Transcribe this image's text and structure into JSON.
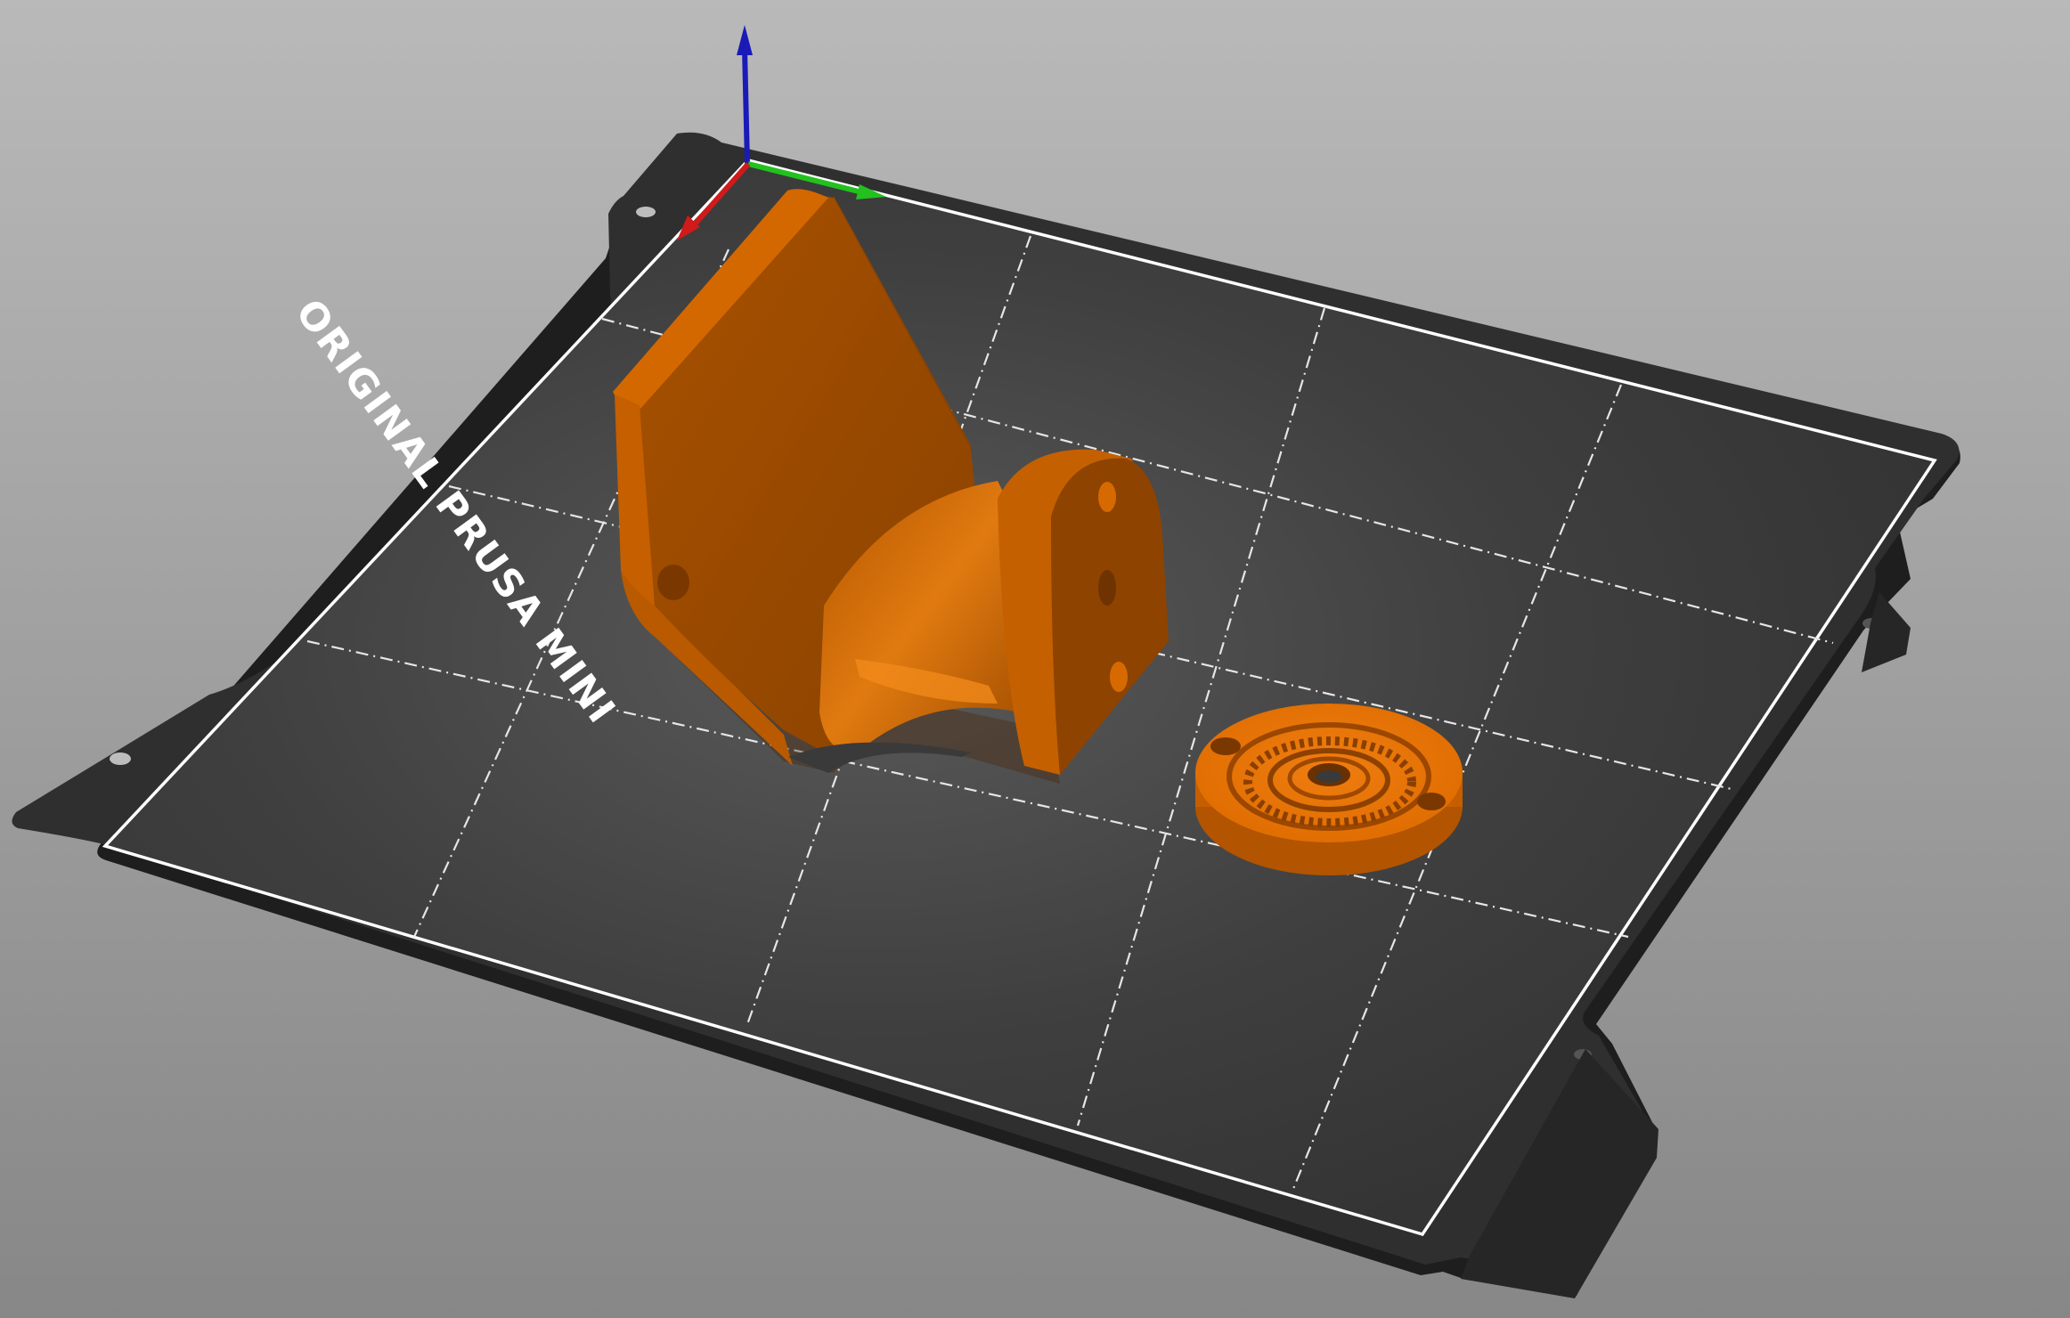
{
  "viewport": {
    "background_top": "#b9b9b9",
    "background_bottom": "#878787"
  },
  "bed": {
    "label": "ORIGINAL PRUSA MINI",
    "sheet_color": "#2f2f2f",
    "surface_color": "#3c3c3c",
    "border_color": "#ffffff",
    "grid_color": "#e6e6e6"
  },
  "axes": {
    "x_color": "#d11a1a",
    "y_color": "#22c11e",
    "z_color": "#1a1ab8"
  },
  "objects": [
    {
      "name": "bracket",
      "color": "#d96a00"
    },
    {
      "name": "gear-disc",
      "color": "#e07000"
    }
  ]
}
